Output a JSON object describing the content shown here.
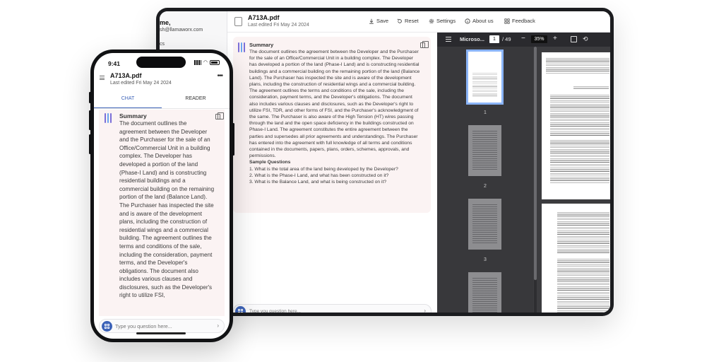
{
  "colors": {
    "accent": "#3d63b8",
    "stripe_purple": "#7b6fd8",
    "stripe_blue": "#6aa5f0",
    "card_bg": "#fbf3f3",
    "pdf_dark": "#2a2a2e"
  },
  "desktop": {
    "account": {
      "name": "me,",
      "email": "sh@llamaworx.com",
      "docs": "cs"
    },
    "header": {
      "doc_icon": "file-icon",
      "title": "A713A.pdf",
      "subtitle": "Last edited Fri May 24 2024",
      "buttons": [
        {
          "label": "Save",
          "icon": "download-icon"
        },
        {
          "label": "Reset",
          "icon": "reset-icon"
        },
        {
          "label": "Settings",
          "icon": "gear-icon"
        },
        {
          "label": "About us",
          "icon": "info-icon"
        },
        {
          "label": "Feedback",
          "icon": "grid-icon"
        }
      ]
    },
    "summary": {
      "title": "Summary",
      "text": "The document outlines the agreement between the Developer and the Purchaser for the sale of an Office/Commercial Unit in a building complex. The Developer has developed a portion of the land (Phase-I Land) and is constructing residential buildings and a commercial building on the remaining portion of the land (Balance Land). The Purchaser has inspected the site and is aware of the development plans, including the construction of residential wings and a commercial building. The agreement outlines the terms and conditions of the sale, including the consideration, payment terms, and the Developer's obligations. The document also includes various clauses and disclosures, such as the Developer's right to utilize FSI, TDR, and other forms of FSI, and the Purchaser's acknowledgment of the same. The Purchaser is also aware of the High Tension (HT) wires passing through the land and the open space deficiency in the buildings constructed on Phase-I Land. The agreement constitutes the entire agreement between the parties and supersedes all prior agreements and understandings. The Purchaser has entered into the agreement with full knowledge of all terms and conditions contained in the documents, papers, plans, orders, schemes, approvals, and permissions.",
      "questions_title": "Sample Questions",
      "questions": [
        "1. What is the total area of the land being developed by the Developer?",
        "2. What is the Phase-I Land, and what has been constructed on it?",
        "3. What is the Balance Land, and what is being constructed on it?"
      ]
    },
    "input": {
      "placeholder": "Type you question here..."
    },
    "pdf": {
      "filename": "Microso...",
      "page": "1",
      "total": "/ 49",
      "zoom": "35%",
      "thumbnails": [
        "1",
        "2",
        "3"
      ]
    }
  },
  "phone": {
    "time": "9:41",
    "title": "A713A.pdf",
    "subtitle": "Last edited Fri May 24 2024",
    "more": "•••",
    "tabs": [
      {
        "label": "CHAT",
        "active": true
      },
      {
        "label": "READER",
        "active": false
      }
    ],
    "summary": {
      "title": "Summary",
      "text": "The document outlines the agreement between the Developer and the Purchaser for the sale of an Office/Commercial Unit in a building complex. The Developer has developed a portion of the land (Phase-I Land) and is constructing residential buildings and a commercial building on the remaining portion of the land (Balance Land). The Purchaser has inspected the site and is aware of the development plans, including the construction of residential wings and a commercial building. The agreement outlines the terms and conditions of the sale, including the consideration, payment terms, and the Developer's obligations. The document also includes various clauses and disclosures, such as the Developer's right to utilize FSI,"
    },
    "input": {
      "placeholder": "Type you question here..."
    }
  }
}
